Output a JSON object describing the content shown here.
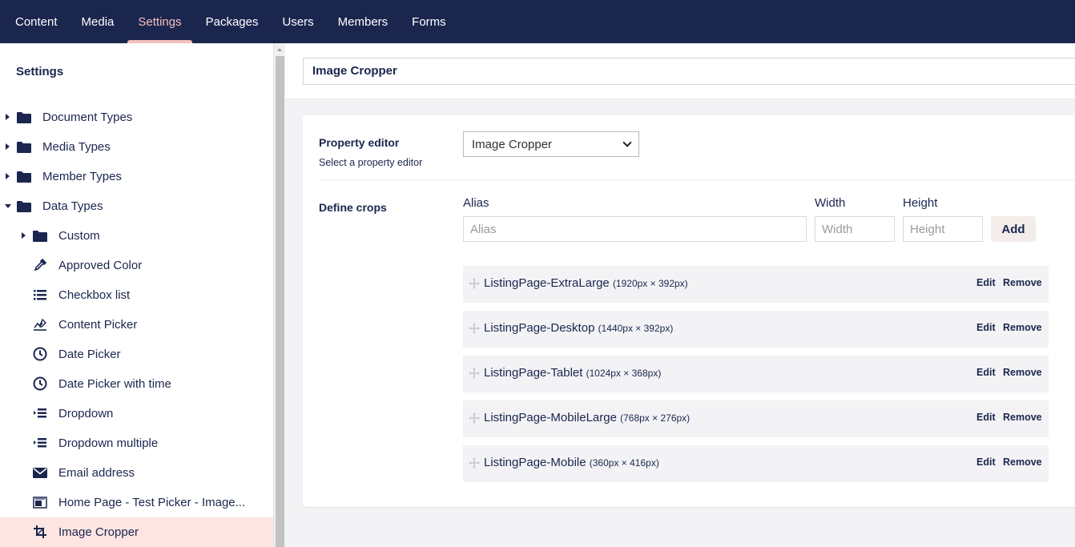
{
  "topnav": {
    "items": [
      {
        "label": "Content",
        "active": false
      },
      {
        "label": "Media",
        "active": false
      },
      {
        "label": "Settings",
        "active": true
      },
      {
        "label": "Packages",
        "active": false
      },
      {
        "label": "Users",
        "active": false
      },
      {
        "label": "Members",
        "active": false
      },
      {
        "label": "Forms",
        "active": false
      }
    ]
  },
  "sidebar": {
    "title": "Settings",
    "items": [
      {
        "label": "Document Types",
        "icon": "folder-icon",
        "caret": "right",
        "level": 0
      },
      {
        "label": "Media Types",
        "icon": "folder-icon",
        "caret": "right",
        "level": 0
      },
      {
        "label": "Member Types",
        "icon": "folder-icon",
        "caret": "right",
        "level": 0
      },
      {
        "label": "Data Types",
        "icon": "folder-icon",
        "caret": "down",
        "level": 0
      },
      {
        "label": "Custom",
        "icon": "folder-icon",
        "caret": "right",
        "level": 1
      },
      {
        "label": "Approved Color",
        "icon": "eyedropper-icon",
        "caret": "none",
        "level": 1
      },
      {
        "label": "Checkbox list",
        "icon": "list-icon",
        "caret": "none",
        "level": 1
      },
      {
        "label": "Content Picker",
        "icon": "content-picker-icon",
        "caret": "none",
        "level": 1
      },
      {
        "label": "Date Picker",
        "icon": "clock-icon",
        "caret": "none",
        "level": 1
      },
      {
        "label": "Date Picker with time",
        "icon": "clock-icon",
        "caret": "none",
        "level": 1
      },
      {
        "label": "Dropdown",
        "icon": "dropdown-icon",
        "caret": "none",
        "level": 1
      },
      {
        "label": "Dropdown multiple",
        "icon": "dropdown-icon",
        "caret": "none",
        "level": 1
      },
      {
        "label": "Email address",
        "icon": "envelope-icon",
        "caret": "none",
        "level": 1
      },
      {
        "label": "Home Page - Test Picker - Image...",
        "icon": "media-picker-icon",
        "caret": "none",
        "level": 1
      },
      {
        "label": "Image Cropper",
        "icon": "crop-icon",
        "caret": "none",
        "level": 1,
        "selected": true
      }
    ]
  },
  "editor": {
    "name_value": "Image Cropper",
    "property_editor": {
      "label": "Property editor",
      "description": "Select a property editor",
      "selected": "Image Cropper"
    },
    "define_crops": {
      "label": "Define crops",
      "alias_label": "Alias",
      "alias_placeholder": "Alias",
      "width_label": "Width",
      "width_placeholder": "Width",
      "height_label": "Height",
      "height_placeholder": "Height",
      "add_label": "Add",
      "edit_label": "Edit",
      "remove_label": "Remove",
      "crops": [
        {
          "name": "ListingPage-ExtraLarge",
          "dims": "(1920px × 392px)"
        },
        {
          "name": "ListingPage-Desktop",
          "dims": "(1440px × 392px)"
        },
        {
          "name": "ListingPage-Tablet",
          "dims": "(1024px × 368px)"
        },
        {
          "name": "ListingPage-MobileLarge",
          "dims": "(768px × 276px)"
        },
        {
          "name": "ListingPage-Mobile",
          "dims": "(360px × 416px)"
        }
      ]
    }
  },
  "colors": {
    "navy": "#1b264f",
    "accent": "#f5c1bc",
    "selected_bg": "#fde5e2"
  }
}
